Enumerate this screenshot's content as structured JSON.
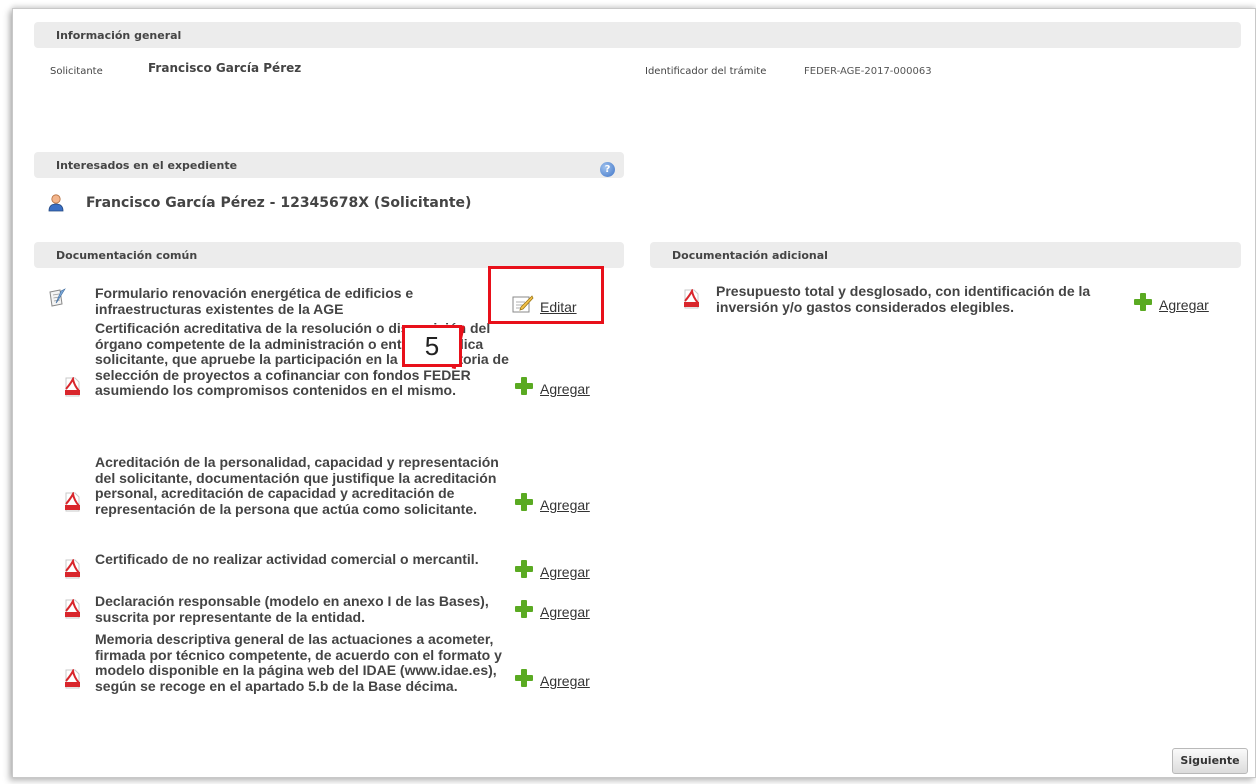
{
  "info_general": {
    "title": "Información general",
    "applicant_label": "Solicitante",
    "applicant_value": "Francisco García Pérez",
    "procedure_label": "Identificador del trámite",
    "procedure_value": "FEDER-AGE-2017-000063"
  },
  "interested": {
    "title": "Interesados en el expediente",
    "help_icon": "help-icon",
    "person": "Francisco García Pérez - 12345678X  (Solicitante)"
  },
  "common_docs": {
    "title": "Documentación común",
    "items": [
      {
        "text": "Formulario renovación energética de edificios e infraestructuras existentes de la AGE",
        "icon": "form-icon",
        "action": "Editar"
      },
      {
        "text": "Certificación acreditativa de la resolución o disposición del órgano competente de la administración o entidad pública solicitante, que apruebe la participación en la convocatoria de selección de proyectos a cofinanciar con fondos FEDER asumiendo los compromisos contenidos en el mismo.",
        "icon": "pdf-icon",
        "action": "Agregar"
      },
      {
        "text": "Acreditación de la personalidad, capacidad y representación del solicitante, documentación que justifique la acreditación personal, acreditación de capacidad y acreditación de representación de la persona que actúa como solicitante.",
        "icon": "pdf-icon",
        "action": "Agregar"
      },
      {
        "text": "Certificado de no realizar actividad comercial o mercantil.",
        "icon": "pdf-icon",
        "action": "Agregar"
      },
      {
        "text": "Declaración responsable (modelo en anexo I de las Bases), suscrita por representante de la entidad.",
        "icon": "pdf-icon",
        "action": "Agregar"
      },
      {
        "text": "Memoria descriptiva general de las actuaciones a acometer, firmada por técnico competente, de acuerdo con el formato y modelo disponible en la página web del IDAE (www.idae.es), según se recoge en el apartado 5.b de la Base décima.",
        "icon": "pdf-icon",
        "action": "Agregar"
      }
    ]
  },
  "additional_docs": {
    "title": "Documentación adicional",
    "items": [
      {
        "text": "Presupuesto total y desglosado, con identificación de la inversión y/o gastos considerados elegibles.",
        "icon": "pdf-icon",
        "action": "Agregar"
      }
    ]
  },
  "annotation": {
    "marker": "5"
  },
  "footer": {
    "next_label": "Siguiente"
  },
  "colors": {
    "highlight": "#e8101a",
    "plus": "#5aaa22",
    "section_bg": "#ececec"
  }
}
